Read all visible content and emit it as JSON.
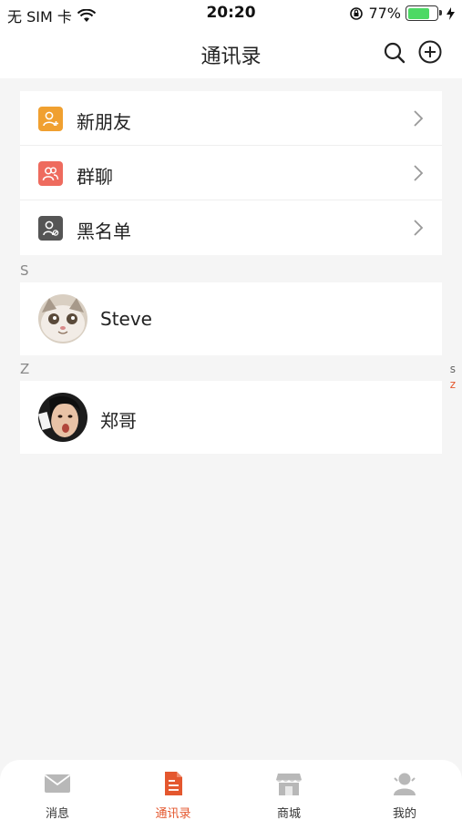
{
  "status": {
    "carrier": "无 SIM 卡",
    "time": "20:20",
    "battery": "77%",
    "battery_level": 0.77
  },
  "nav": {
    "title": "通讯录",
    "search_icon": "search-icon",
    "add_icon": "plus-circle-icon"
  },
  "menu": {
    "items": [
      {
        "label": "新朋友",
        "icon": "add-friend-icon",
        "color": "#f0a030"
      },
      {
        "label": "群聊",
        "icon": "group-icon",
        "color": "#ee6b5e"
      },
      {
        "label": "黑名单",
        "icon": "blocked-user-icon",
        "color": "#555555"
      }
    ]
  },
  "sections": [
    {
      "letter": "S",
      "contacts": [
        {
          "name": "Steve"
        }
      ]
    },
    {
      "letter": "Z",
      "contacts": [
        {
          "name": "郑哥"
        }
      ]
    }
  ],
  "index": [
    "s",
    "z"
  ],
  "tabs": [
    {
      "label": "消息",
      "icon": "mail-icon"
    },
    {
      "label": "通讯录",
      "icon": "contacts-icon",
      "active": true
    },
    {
      "label": "商城",
      "icon": "store-icon"
    },
    {
      "label": "我的",
      "icon": "profile-icon"
    }
  ],
  "colors": {
    "accent": "#e4572e"
  }
}
